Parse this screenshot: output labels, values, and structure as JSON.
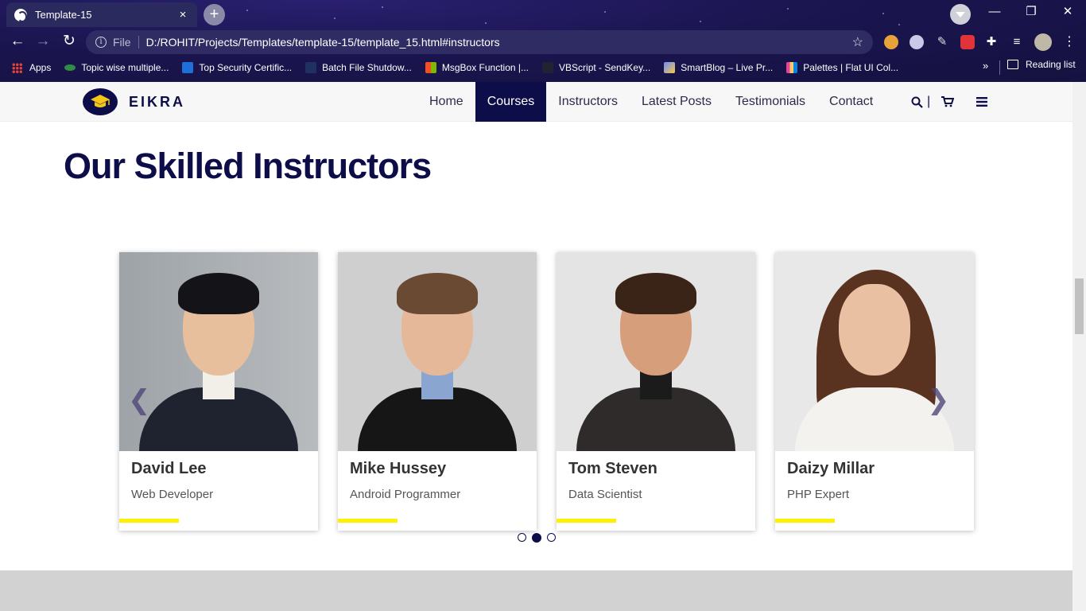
{
  "browser": {
    "tab_title": "Template-15",
    "tab_close": "×",
    "new_tab": "+",
    "omnibox_label": "File",
    "url": "D:/ROHIT/Projects/Templates/template-15/template_15.html#instructors",
    "window_controls": [
      "—",
      "❐",
      "✕"
    ],
    "bookmarks": [
      {
        "label": "Apps",
        "icon": "apps-grid-icon",
        "color": "#ea4335"
      },
      {
        "label": "Topic wise multiple...",
        "icon": "gfg-icon",
        "color": "#2f8d46"
      },
      {
        "label": "Top Security Certific...",
        "icon": "certificate-icon",
        "color": "#1e6fd9"
      },
      {
        "label": "Batch File Shutdow...",
        "icon": "file-icon",
        "color": "#203060"
      },
      {
        "label": "MsgBox Function |...",
        "icon": "windows-icon",
        "color": "#f25022"
      },
      {
        "label": "VBScript - SendKey...",
        "icon": "script-icon",
        "color": "#222233"
      },
      {
        "label": "SmartBlog – Live Pr...",
        "icon": "smartblog-icon",
        "color": "#6c8cff"
      },
      {
        "label": "Palettes | Flat UI Col...",
        "icon": "palette-icon",
        "color": "#e84393"
      }
    ],
    "bookmarks_more": "»",
    "reading_list": "Reading list"
  },
  "site": {
    "brand": "EIKRA",
    "nav": [
      {
        "label": "Home",
        "active": false
      },
      {
        "label": "Courses",
        "active": true
      },
      {
        "label": "Instructors",
        "active": false
      },
      {
        "label": "Latest Posts",
        "active": false
      },
      {
        "label": "Testimonials",
        "active": false
      },
      {
        "label": "Contact",
        "active": false
      }
    ],
    "search_separator": "|",
    "section_title": "Our Skilled Instructors",
    "instructors": [
      {
        "name": "David Lee",
        "role": "Web Developer"
      },
      {
        "name": "Mike Hussey",
        "role": "Android Programmer"
      },
      {
        "name": "Tom Steven",
        "role": "Data Scientist"
      },
      {
        "name": "Daizy Millar",
        "role": "PHP Expert"
      }
    ],
    "carousel": {
      "prev": "❮",
      "next": "❯",
      "pages": 3,
      "active_page": 2
    },
    "colors": {
      "primary": "#0d0d4a",
      "accent": "#fdf000"
    }
  }
}
